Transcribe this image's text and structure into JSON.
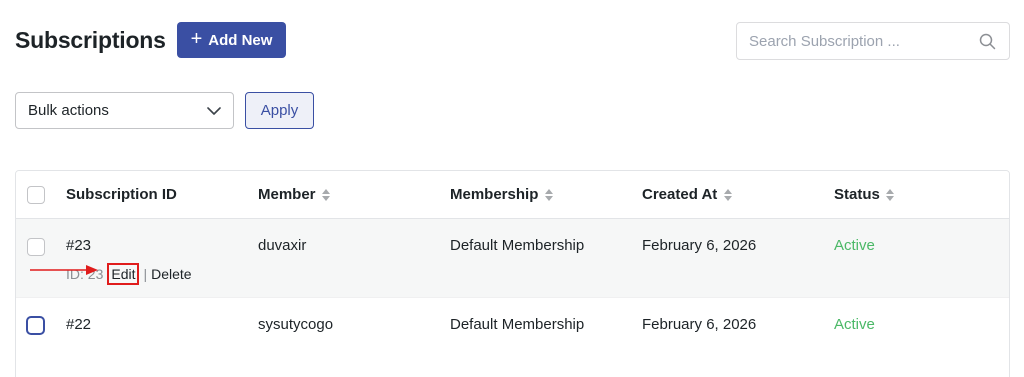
{
  "header": {
    "title": "Subscriptions",
    "add_new_label": "Add New"
  },
  "search": {
    "placeholder": "Search Subscription ...",
    "value": ""
  },
  "bulk": {
    "selected": "Bulk actions",
    "apply_label": "Apply"
  },
  "table": {
    "columns": {
      "id": "Subscription ID",
      "member": "Member",
      "membership": "Membership",
      "created": "Created At",
      "status": "Status"
    },
    "rows": [
      {
        "id": "#23",
        "member": "duvaxir",
        "membership": "Default Membership",
        "created": "February 6, 2026",
        "status": "Active",
        "row_id": "ID: 23",
        "edit_label": "Edit",
        "delete_label": "Delete"
      },
      {
        "id": "#22",
        "member": "sysutycogo",
        "membership": "Default Membership",
        "created": "February 6, 2026",
        "status": "Active"
      }
    ]
  },
  "colors": {
    "accent": "#3a4fa3",
    "status_active": "#4ab866",
    "annotation": "#e01c1c"
  },
  "icons": [
    "plus-icon",
    "search-icon",
    "chevron-down-icon",
    "sort-icon",
    "annotation-arrow"
  ]
}
